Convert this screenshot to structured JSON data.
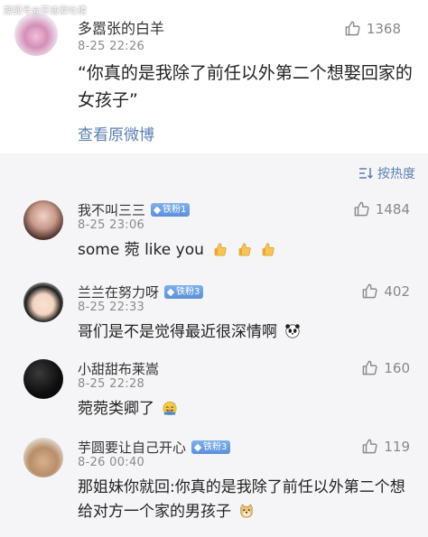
{
  "watermark": "搜狐号@芬迪爱吐槽",
  "post": {
    "author": "多嚣张的白羊",
    "time": "8-25 22:26",
    "likes": "1368",
    "text": "“你真的是我除了前任以外第二个想娶回家的女孩子”",
    "view_original": "查看原微博",
    "avatar_icon": "avatar-icon"
  },
  "sort": {
    "label": "按热度",
    "icon": "sort-icon"
  },
  "badge_icon": "diamond-icon",
  "comments": [
    {
      "author": "我不叫三三",
      "badge": "铁粉1",
      "time": "8-25 23:06",
      "likes": "1484",
      "text": "some 菀 like you",
      "emojis": [
        "thumbs-up-emoji",
        "thumbs-up-emoji",
        "thumbs-up-emoji"
      ]
    },
    {
      "author": "兰兰在努力呀",
      "badge": "铁粉3",
      "time": "8-25 22:33",
      "likes": "402",
      "text": "哥们是不是觉得最近很深情啊",
      "emojis": [
        "panda-emoji"
      ]
    },
    {
      "author": "小甜甜布莱嵩",
      "badge": "",
      "time": "8-25 22:28",
      "likes": "160",
      "text": "菀菀类卿了",
      "emojis": [
        "sweat-smile-emoji"
      ]
    },
    {
      "author": "芋圆要让自己开心",
      "badge": "铁粉3",
      "time": "8-26 00:40",
      "likes": "119",
      "text": "那姐妹你就回:你真的是我除了前任以外第二个想给对方一个家的男孩子",
      "emojis": [
        "doge-emoji"
      ]
    }
  ],
  "colors": {
    "link": "#5a7fb3",
    "badge": "#5b8fd8",
    "section_bg": "#f5f5f7"
  }
}
